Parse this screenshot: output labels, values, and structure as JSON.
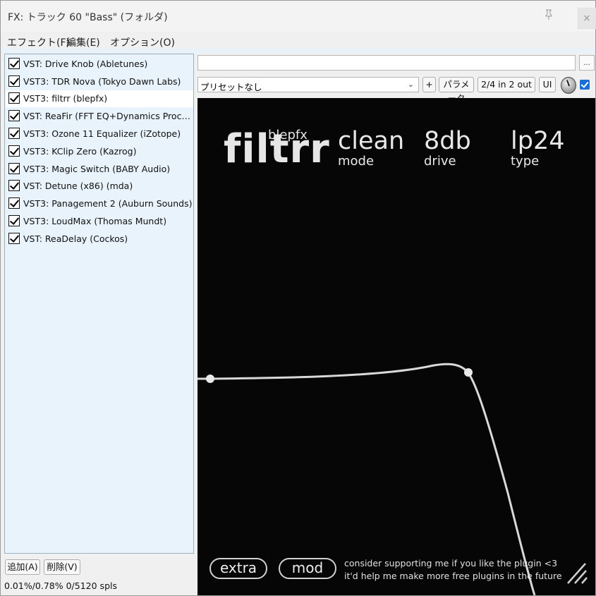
{
  "window": {
    "title": "FX: トラック 60 \"Bass\" (フォルダ)",
    "close_label": "×"
  },
  "menu": [
    {
      "label": "エフェクト(F)"
    },
    {
      "label": "編集(E)"
    },
    {
      "label": "オプション(O)"
    }
  ],
  "fx_chain": [
    {
      "label": "VST: Drive Knob (Abletunes)",
      "enabled": true
    },
    {
      "label": "VST3: TDR Nova (Tokyo Dawn Labs)",
      "enabled": true
    },
    {
      "label": "VST3: filtrr (blepfx)",
      "enabled": true,
      "selected": true
    },
    {
      "label": "VST: ReaFir (FFT EQ+Dynamics Processor (Cockos)",
      "enabled": true
    },
    {
      "label": "VST3: Ozone 11 Equalizer (iZotope)",
      "enabled": true
    },
    {
      "label": "VST3: KClip Zero (Kazrog)",
      "enabled": true
    },
    {
      "label": "VST3: Magic Switch (BABY Audio)",
      "enabled": true
    },
    {
      "label": "VST: Detune (x86) (mda)",
      "enabled": true
    },
    {
      "label": "VST3: Panagement 2 (Auburn Sounds)",
      "enabled": true
    },
    {
      "label": "VST3: LoudMax (Thomas Mundt)",
      "enabled": true
    },
    {
      "label": "VST: ReaDelay (Cockos)",
      "enabled": true
    }
  ],
  "buttons": {
    "add": "追加(A)",
    "remove": "削除(V)",
    "dots": "...",
    "plus": "+",
    "params": "パラメータ",
    "io": "2/4 in 2 out",
    "ui": "UI"
  },
  "status": "0.01%/0.78% 0/5120 spls",
  "preset": {
    "value": "プリセットなし"
  },
  "plugin": {
    "logo": "filtrr",
    "brand": "blepfx",
    "params": [
      {
        "value": "clean",
        "label": "mode"
      },
      {
        "value": "8db",
        "label": "drive"
      },
      {
        "value": "lp24",
        "label": "type"
      }
    ],
    "extra_label": "extra",
    "mod_label": "mod",
    "message_line1": "consider supporting me if you like the plugin <3",
    "message_line2": "it'd help me make more free plugins in the future"
  },
  "colors": {
    "plugin_bg": "#060606",
    "list_bg": "#e8f3fc",
    "accent": "#1a6fd6"
  }
}
